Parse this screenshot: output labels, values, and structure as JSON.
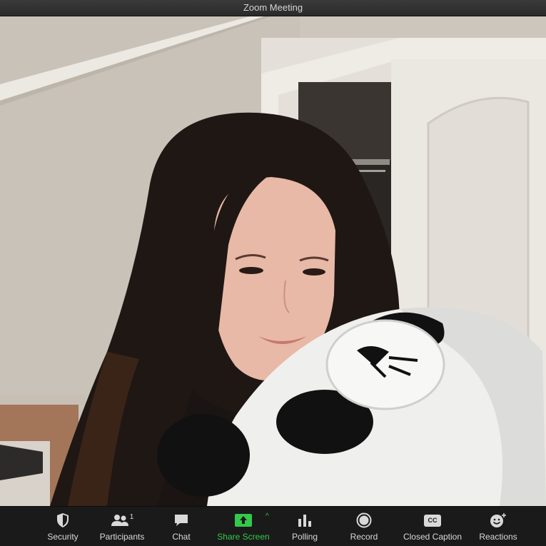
{
  "window": {
    "title": "Zoom Meeting"
  },
  "toolbar": {
    "items": [
      {
        "label": "Security",
        "icon": "shield-icon"
      },
      {
        "label": "Participants",
        "icon": "participants-icon",
        "count": "1"
      },
      {
        "label": "Chat",
        "icon": "chat-bubble-icon"
      },
      {
        "label": "Share Screen",
        "icon": "share-screen-icon"
      },
      {
        "label": "Polling",
        "icon": "bar-chart-icon"
      },
      {
        "label": "Record",
        "icon": "record-icon"
      },
      {
        "label": "Closed Caption",
        "icon": "cc-icon",
        "badge": "CC"
      },
      {
        "label": "Reactions",
        "icon": "emoji-add-icon"
      }
    ]
  },
  "colors": {
    "toolbar_bg": "#1a1a1a",
    "share_accent": "#34c94a",
    "text": "#d9d9d9"
  }
}
